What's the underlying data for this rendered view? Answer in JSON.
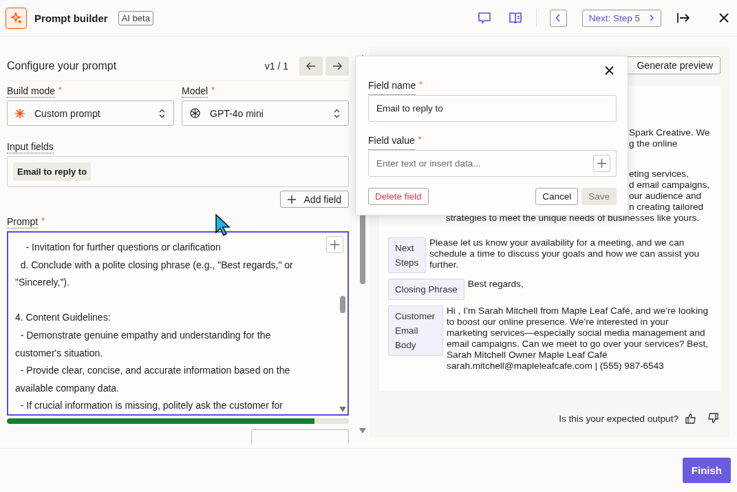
{
  "header": {
    "title": "Prompt builder",
    "badge": "AI beta",
    "next_button": "Next: Step 5"
  },
  "configure": {
    "title": "Configure your prompt",
    "version": "v1 / 1"
  },
  "selects": [
    {
      "label": "Build mode",
      "mark": "*",
      "value": "Custom prompt",
      "kind": "spark"
    },
    {
      "label": "Model",
      "mark": "*",
      "value": "GPT-4o mini",
      "kind": "model"
    }
  ],
  "input_fields": {
    "label": "Input fields",
    "chips": [
      "Email to reply to"
    ],
    "add_button": "Add field"
  },
  "prompt": {
    "label": "Prompt",
    "mark": "*",
    "text": "    - Invitation for further questions or clarification\n  d. Conclude with a polite closing phrase (e.g., \"Best regards,\" or\n\"Sincerely,\").\n\n4. Content Guidelines:\n  - Demonstrate genuine empathy and understanding for the\ncustomer's situation.\n  - Provide clear, concise, and accurate information based on the\navailable company data.\n  - If crucial information is missing, politely ask the customer for",
    "level": 0.9
  },
  "preview": {
    "generate_button": "Generate preview",
    "sections": [
      {
        "kind": "covered",
        "lines": [
          {
            "kind": "clipped",
            "text": "Spark Creative. We"
          },
          {
            "kind": "clipped",
            "text": "g the online"
          }
        ]
      },
      {
        "kind": "covered",
        "lines": [
          {
            "kind": "clipped",
            "text": "eting services,"
          },
          {
            "kind": "clipped",
            "text": "d email campaigns,"
          },
          {
            "kind": "clipped",
            "text": "our audience and"
          },
          {
            "kind": "clipped",
            "text": "n creating tailored"
          },
          {
            "kind": "full",
            "text": "strategies to meet the unique needs of businesses like yours."
          }
        ]
      },
      {
        "kind": "labeled",
        "label": "Next Steps",
        "text": "Please let us know your availability for a meeting, and we can schedule a time to discuss your goals and how we can assist you further."
      },
      {
        "kind": "labeled",
        "label": "Closing Phrase",
        "text": "Best regards,"
      },
      {
        "kind": "labeled",
        "label": "Customer Email Body",
        "text": "Hi , I’m Sarah Mitchell from Maple Leaf Café, and we’re looking to boost our online presence. We’re interested in your marketing services—especially social media management and email campaigns. Can we meet to go over your services? Best, Sarah Mitchell Owner Maple Leaf Café sarah.mitchell@mapleleafcafe.com | (555) 987-6543"
      }
    ],
    "feedback": "Is this your expected output?"
  },
  "popover": {
    "field_name": {
      "label": "Field name",
      "mark": "*",
      "value": "Email to reply to"
    },
    "field_value": {
      "label": "Field value",
      "mark": "*",
      "placeholder": "Enter text or insert data..."
    },
    "delete_button": "Delete field",
    "cancel_button": "Cancel",
    "save_button": {
      "label": "Save",
      "disabled": true
    }
  },
  "footer": {
    "finish_button": "Finish"
  }
}
